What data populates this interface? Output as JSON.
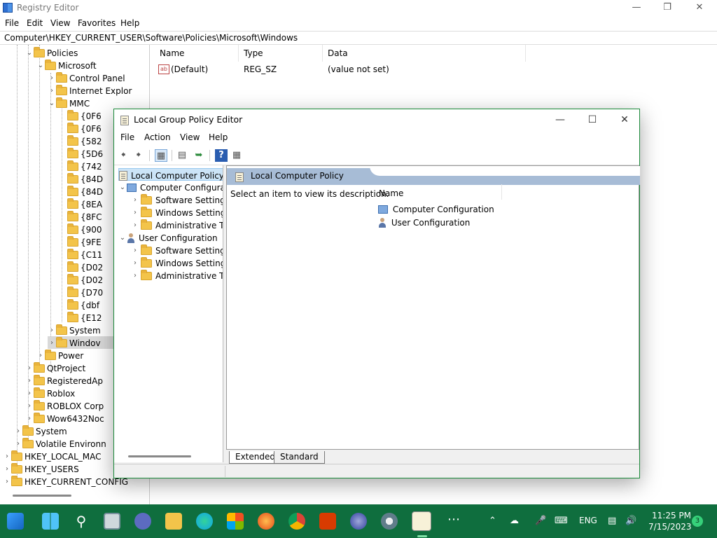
{
  "registry": {
    "title": "Registry Editor",
    "menu": [
      "File",
      "Edit",
      "View",
      "Favorites",
      "Help"
    ],
    "address": "Computer\\HKEY_CURRENT_USER\\Software\\Policies\\Microsoft\\Windows",
    "tree": [
      {
        "label": "Policies",
        "level": 3,
        "expanded": true
      },
      {
        "label": "Microsoft",
        "level": 4,
        "expanded": true
      },
      {
        "label": "Control Panel",
        "level": 5
      },
      {
        "label": "Internet Explor",
        "level": 5
      },
      {
        "label": "MMC",
        "level": 5,
        "expanded": true
      },
      {
        "label": "{0F6",
        "level": 6
      },
      {
        "label": "{0F6",
        "level": 6
      },
      {
        "label": "{582",
        "level": 6
      },
      {
        "label": "{5D6",
        "level": 6
      },
      {
        "label": "{742",
        "level": 6
      },
      {
        "label": "{84D",
        "level": 6
      },
      {
        "label": "{84D",
        "level": 6
      },
      {
        "label": "{8EA",
        "level": 6
      },
      {
        "label": "{8FC",
        "level": 6
      },
      {
        "label": "{900",
        "level": 6
      },
      {
        "label": "{9FE",
        "level": 6
      },
      {
        "label": "{C11",
        "level": 6
      },
      {
        "label": "{D02",
        "level": 6
      },
      {
        "label": "{D02",
        "level": 6
      },
      {
        "label": "{D70",
        "level": 6
      },
      {
        "label": "{dbf",
        "level": 6
      },
      {
        "label": "{E12",
        "level": 6
      },
      {
        "label": "System",
        "level": 5
      },
      {
        "label": "Windov",
        "level": 5,
        "selected": true
      },
      {
        "label": "Power",
        "level": 4
      },
      {
        "label": "QtProject",
        "level": 3
      },
      {
        "label": "RegisteredAp",
        "level": 3
      },
      {
        "label": "Roblox",
        "level": 3
      },
      {
        "label": "ROBLOX Corp",
        "level": 3
      },
      {
        "label": "Wow6432Noc",
        "level": 3
      },
      {
        "label": "System",
        "level": 2
      },
      {
        "label": "Volatile Environn",
        "level": 2
      },
      {
        "label": "HKEY_LOCAL_MAC",
        "level": 1
      },
      {
        "label": "HKEY_USERS",
        "level": 1
      },
      {
        "label": "HKEY_CURRENT_CONFIG",
        "level": 1
      }
    ],
    "columns": [
      "Name",
      "Type",
      "Data"
    ],
    "values": [
      {
        "name": "(Default)",
        "type": "REG_SZ",
        "data": "(value not set)"
      }
    ]
  },
  "gpedit": {
    "title": "Local Group Policy Editor",
    "menu": [
      "File",
      "Action",
      "View",
      "Help"
    ],
    "tree": [
      {
        "label": "Local Computer Policy",
        "level": 0,
        "icon": "doc",
        "selected": true
      },
      {
        "label": "Computer Configura",
        "level": 1,
        "icon": "pc",
        "expanded": true
      },
      {
        "label": "Software Settings",
        "level": 2,
        "icon": "folder"
      },
      {
        "label": "Windows Setting",
        "level": 2,
        "icon": "folder"
      },
      {
        "label": "Administrative Te",
        "level": 2,
        "icon": "folder"
      },
      {
        "label": "User Configuration",
        "level": 1,
        "icon": "user",
        "expanded": true
      },
      {
        "label": "Software Settings",
        "level": 2,
        "icon": "folder"
      },
      {
        "label": "Windows Setting",
        "level": 2,
        "icon": "folder"
      },
      {
        "label": "Administrative Te",
        "level": 2,
        "icon": "folder"
      }
    ],
    "header": "Local Computer Policy",
    "description": "Select an item to view its description.",
    "list_header": "Name",
    "items": [
      {
        "label": "Computer Configuration",
        "icon": "pc"
      },
      {
        "label": "User Configuration",
        "icon": "user"
      }
    ],
    "tabs": [
      "Extended",
      "Standard"
    ]
  },
  "taskbar": {
    "language": "ENG",
    "time": "11:25 PM",
    "date": "7/15/2023",
    "notification_count": "3",
    "accent": "#0f6e3e"
  }
}
